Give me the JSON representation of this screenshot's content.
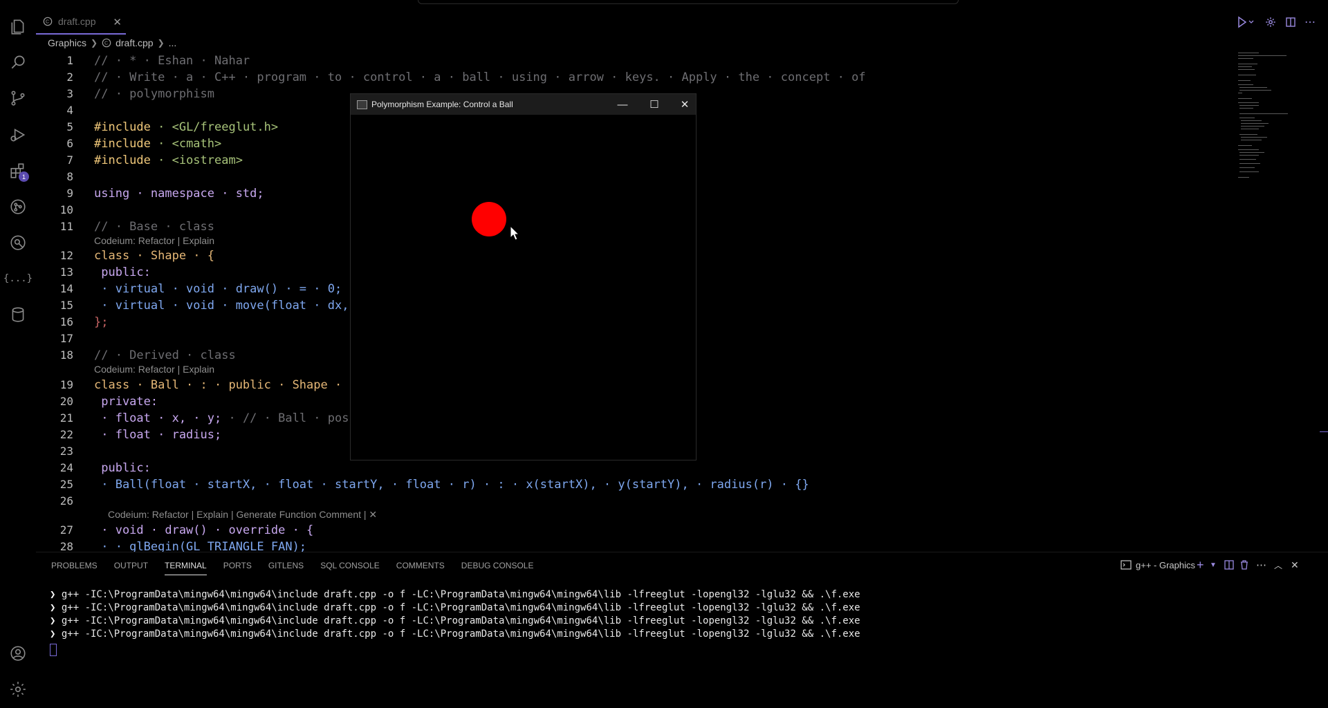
{
  "tab": {
    "filename": "draft.cpp",
    "close": "✕"
  },
  "breadcrumb": {
    "folder": "Graphics",
    "file": "draft.cpp",
    "more": "..."
  },
  "editor": {
    "lines": [
      {
        "n": "1",
        "k": "code"
      },
      {
        "n": "2",
        "k": "code"
      },
      {
        "n": "3",
        "k": "code"
      },
      {
        "n": "4",
        "k": "code"
      },
      {
        "n": "5",
        "k": "code"
      },
      {
        "n": "6",
        "k": "code"
      },
      {
        "n": "7",
        "k": "code"
      },
      {
        "n": "8",
        "k": "code"
      },
      {
        "n": "9",
        "k": "code"
      },
      {
        "n": "10",
        "k": "code"
      },
      {
        "n": "11",
        "k": "code"
      },
      {
        "n": "12",
        "k": "code"
      },
      {
        "n": "13",
        "k": "code"
      },
      {
        "n": "14",
        "k": "code"
      },
      {
        "n": "15",
        "k": "code"
      },
      {
        "n": "16",
        "k": "code"
      },
      {
        "n": "17",
        "k": "code"
      },
      {
        "n": "18",
        "k": "code"
      },
      {
        "n": "19",
        "k": "code"
      },
      {
        "n": "20",
        "k": "code"
      },
      {
        "n": "21",
        "k": "code"
      },
      {
        "n": "22",
        "k": "code"
      },
      {
        "n": "23",
        "k": "code"
      },
      {
        "n": "24",
        "k": "code"
      },
      {
        "n": "25",
        "k": "code"
      },
      {
        "n": "26",
        "k": "code"
      },
      {
        "n": "27",
        "k": "code"
      },
      {
        "n": "28",
        "k": "code"
      }
    ],
    "code": {
      "l1": "// · * · Eshan · Nahar",
      "l2": "// · Write · a · C++ · program · to · control · a · ball · using · arrow · keys. · Apply · the · concept · of",
      "l3": "// · polymorphism",
      "l5a": "#include",
      "l5b": " · <GL/freeglut.h>",
      "l6a": "#include",
      "l6b": " · <cmath>",
      "l7a": "#include",
      "l7b": " · <iostream>",
      "l9": "using · namespace · std;",
      "l11": "// · Base · class",
      "lens1": "Codeium: Refactor | Explain",
      "l12": "class · Shape · {",
      "l13": " public:",
      "l14a": " · virtual · void · draw() · = · 0;",
      "l14b": " · · · · · · · · ·",
      "l15": " · virtual · void · move(float · dx, · float ·",
      "l16": "};",
      "l18": "// · Derived · class",
      "lens2": "Codeium: Refactor | Explain",
      "l19": "class · Ball · : · public · Shape · {",
      "l20": " private:",
      "l21a": " · float · x, · y;",
      "l21b": " · // · Ball · position",
      "l22": " · float · radius;",
      "l24": " public:",
      "l25": " · Ball(float · startX, · float · startY, · float · r) · : · x(startX), · y(startY), · radius(r) · {}",
      "lens3": "Codeium: Refactor | Explain | Generate Function Comment | ✕",
      "l27": " · void · draw() · override · {",
      "l28": " · · glBegin(GL_TRIANGLE_FAN);"
    }
  },
  "glut": {
    "title": "Polymorphism Example: Control a Ball",
    "ball_color": "#ff0000"
  },
  "panel": {
    "tabs": [
      "PROBLEMS",
      "OUTPUT",
      "TERMINAL",
      "PORTS",
      "GITLENS",
      "SQL CONSOLE",
      "COMMENTS",
      "DEBUG CONSOLE"
    ],
    "active_tab": "TERMINAL",
    "terminal_name": "g++ - Graphics",
    "terminal_lines": [
      "g++ -IC:\\ProgramData\\mingw64\\mingw64\\include draft.cpp -o f -LC:\\ProgramData\\mingw64\\mingw64\\lib -lfreeglut -lopengl32 -lglu32 && .\\f.exe",
      "g++ -IC:\\ProgramData\\mingw64\\mingw64\\include draft.cpp -o f -LC:\\ProgramData\\mingw64\\mingw64\\lib -lfreeglut -lopengl32 -lglu32 && .\\f.exe",
      "g++ -IC:\\ProgramData\\mingw64\\mingw64\\include draft.cpp -o f -LC:\\ProgramData\\mingw64\\mingw64\\lib -lfreeglut -lopengl32 -lglu32 && .\\f.exe",
      "g++ -IC:\\ProgramData\\mingw64\\mingw64\\include draft.cpp -o f -LC:\\ProgramData\\mingw64\\mingw64\\lib -lfreeglut -lopengl32 -lglu32 && .\\f.exe"
    ]
  },
  "activity": {
    "extensions_badge": "1"
  },
  "colors": {
    "accent": "#7a6bd8",
    "background": "#000000"
  }
}
